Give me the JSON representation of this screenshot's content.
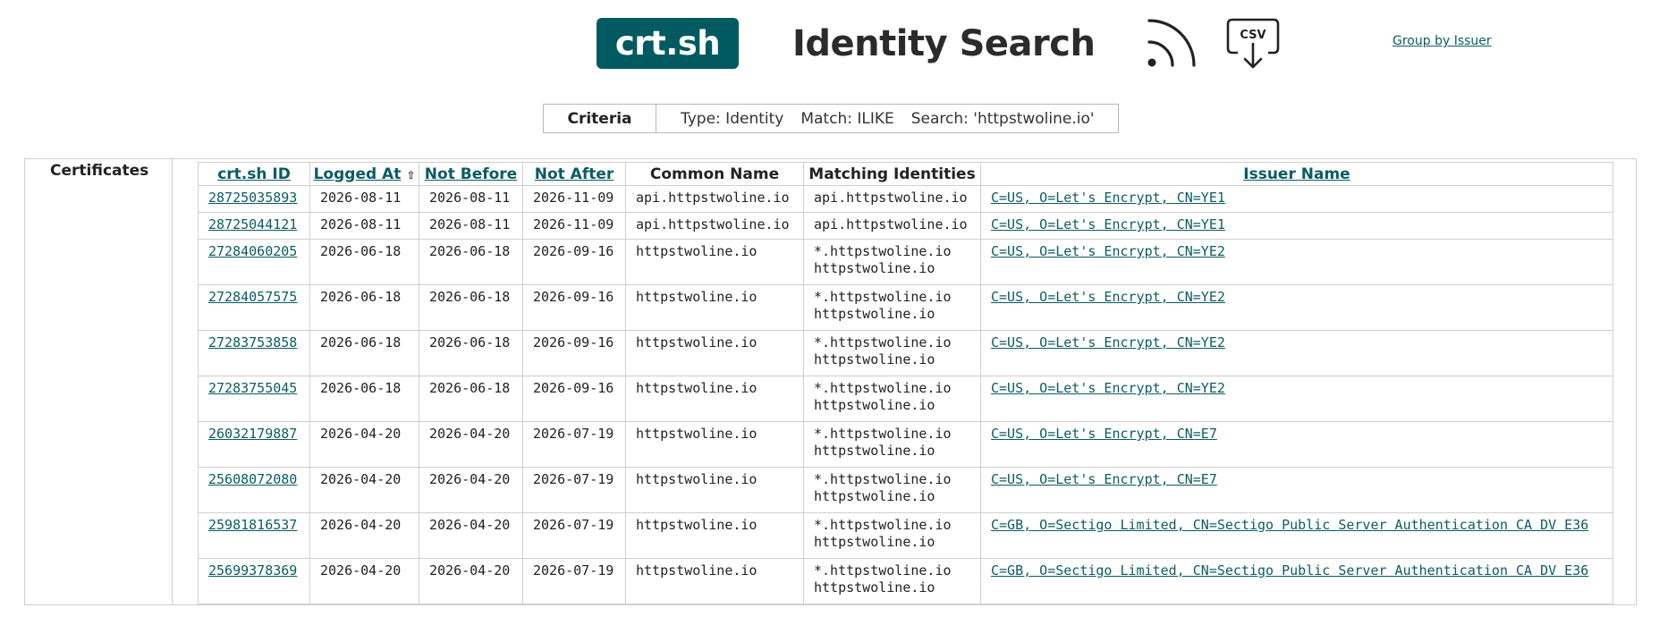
{
  "header": {
    "logo_text": "crt.sh",
    "title": "Identity Search",
    "rss_icon": "rss-icon",
    "csv_icon_label": "CSV",
    "group_link": "Group by Issuer"
  },
  "criteria": {
    "label": "Criteria",
    "type": "Type: Identity",
    "match": "Match: ILIKE",
    "search": "Search: 'httpstwoline.io'"
  },
  "certificates": {
    "section_label": "Certificates",
    "columns": {
      "id": "crt.sh ID",
      "logged_at": "Logged At",
      "sort_arrow": "⇧",
      "not_before": "Not Before",
      "not_after": "Not After",
      "common_name": "Common Name",
      "matching_identities": "Matching Identities",
      "issuer_name": "Issuer Name"
    },
    "rows": [
      {
        "id": "28725035893",
        "logged_at": "2026-08-11",
        "not_before": "2026-08-11",
        "not_after": "2026-11-09",
        "common_name": "api.httpstwoline.io",
        "identities": [
          "api.httpstwoline.io"
        ],
        "issuer": "C=US, O=Let's Encrypt, CN=YE1"
      },
      {
        "id": "28725044121",
        "logged_at": "2026-08-11",
        "not_before": "2026-08-11",
        "not_after": "2026-11-09",
        "common_name": "api.httpstwoline.io",
        "identities": [
          "api.httpstwoline.io"
        ],
        "issuer": "C=US, O=Let's Encrypt, CN=YE1"
      },
      {
        "id": "27284060205",
        "logged_at": "2026-06-18",
        "not_before": "2026-06-18",
        "not_after": "2026-09-16",
        "common_name": "httpstwoline.io",
        "identities": [
          "*.httpstwoline.io",
          "httpstwoline.io"
        ],
        "issuer": "C=US, O=Let's Encrypt, CN=YE2"
      },
      {
        "id": "27284057575",
        "logged_at": "2026-06-18",
        "not_before": "2026-06-18",
        "not_after": "2026-09-16",
        "common_name": "httpstwoline.io",
        "identities": [
          "*.httpstwoline.io",
          "httpstwoline.io"
        ],
        "issuer": "C=US, O=Let's Encrypt, CN=YE2"
      },
      {
        "id": "27283753858",
        "logged_at": "2026-06-18",
        "not_before": "2026-06-18",
        "not_after": "2026-09-16",
        "common_name": "httpstwoline.io",
        "identities": [
          "*.httpstwoline.io",
          "httpstwoline.io"
        ],
        "issuer": "C=US, O=Let's Encrypt, CN=YE2"
      },
      {
        "id": "27283755045",
        "logged_at": "2026-06-18",
        "not_before": "2026-06-18",
        "not_after": "2026-09-16",
        "common_name": "httpstwoline.io",
        "identities": [
          "*.httpstwoline.io",
          "httpstwoline.io"
        ],
        "issuer": "C=US, O=Let's Encrypt, CN=YE2"
      },
      {
        "id": "26032179887",
        "logged_at": "2026-04-20",
        "not_before": "2026-04-20",
        "not_after": "2026-07-19",
        "common_name": "httpstwoline.io",
        "identities": [
          "*.httpstwoline.io",
          "httpstwoline.io"
        ],
        "issuer": "C=US, O=Let's Encrypt, CN=E7"
      },
      {
        "id": "25608072080",
        "logged_at": "2026-04-20",
        "not_before": "2026-04-20",
        "not_after": "2026-07-19",
        "common_name": "httpstwoline.io",
        "identities": [
          "*.httpstwoline.io",
          "httpstwoline.io"
        ],
        "issuer": "C=US, O=Let's Encrypt, CN=E7"
      },
      {
        "id": "25981816537",
        "logged_at": "2026-04-20",
        "not_before": "2026-04-20",
        "not_after": "2026-07-19",
        "common_name": "httpstwoline.io",
        "identities": [
          "*.httpstwoline.io",
          "httpstwoline.io"
        ],
        "issuer": "C=GB, O=Sectigo Limited, CN=Sectigo Public Server Authentication CA DV E36"
      },
      {
        "id": "25699378369",
        "logged_at": "2026-04-20",
        "not_before": "2026-04-20",
        "not_after": "2026-07-19",
        "common_name": "httpstwoline.io",
        "identities": [
          "*.httpstwoline.io",
          "httpstwoline.io"
        ],
        "issuer": "C=GB, O=Sectigo Limited, CN=Sectigo Public Server Authentication CA DV E36"
      }
    ]
  }
}
